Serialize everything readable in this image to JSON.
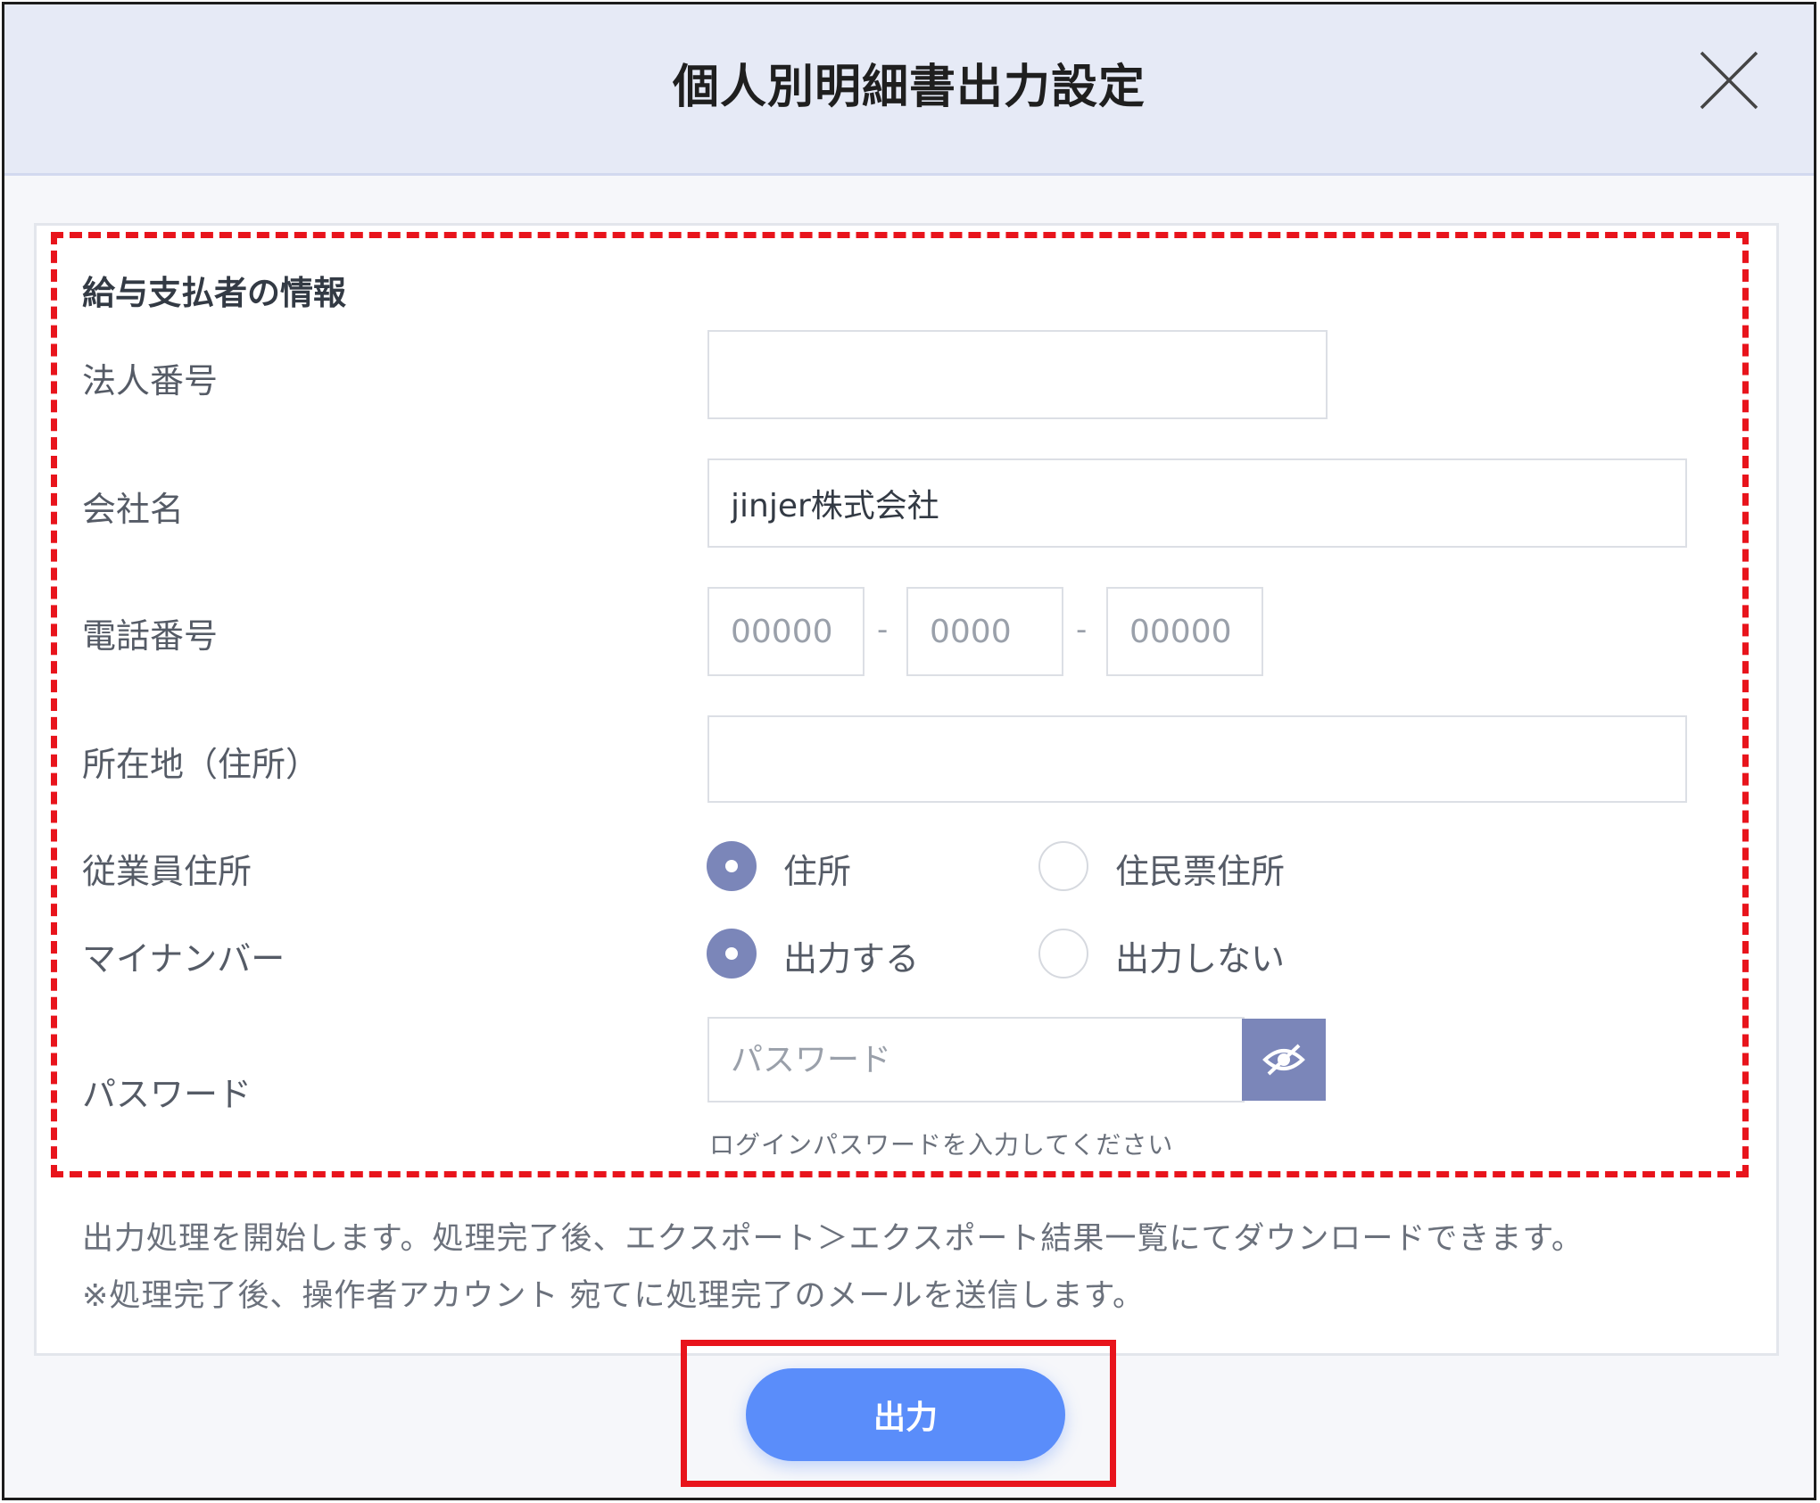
{
  "dialog": {
    "title": "個人別明細書出力設定"
  },
  "form": {
    "section_title": "給与支払者の情報",
    "corporate_number": {
      "label": "法人番号",
      "value": ""
    },
    "company_name": {
      "label": "会社名",
      "value": "jinjer株式会社"
    },
    "phone": {
      "label": "電話番号",
      "part1_placeholder": "00000",
      "part2_placeholder": "0000",
      "part3_placeholder": "00000",
      "separator": "-"
    },
    "address": {
      "label": "所在地（住所）",
      "value": ""
    },
    "employee_address": {
      "label": "従業員住所",
      "options": [
        {
          "label": "住所",
          "selected": true
        },
        {
          "label": "住民票住所",
          "selected": false
        }
      ]
    },
    "my_number": {
      "label": "マイナンバー",
      "options": [
        {
          "label": "出力する",
          "selected": true
        },
        {
          "label": "出力しない",
          "selected": false
        }
      ]
    },
    "password": {
      "label": "パスワード",
      "placeholder": "パスワード",
      "hint": "ログインパスワードを入力してください",
      "toggle_icon": "eye-slash-icon"
    }
  },
  "notes": {
    "line1": "出力処理を開始します。処理完了後、エクスポート＞エクスポート結果一覧にてダウンロードできます。",
    "line2": "※処理完了後、操作者アカウント 宛てに処理完了のメールを送信します。"
  },
  "actions": {
    "submit_label": "出力"
  },
  "colors": {
    "header_bg": "#e6eaf6",
    "radio_selected": "#7b86b9",
    "submit_button": "#5a8dfa",
    "highlight_red": "#e8141c"
  }
}
